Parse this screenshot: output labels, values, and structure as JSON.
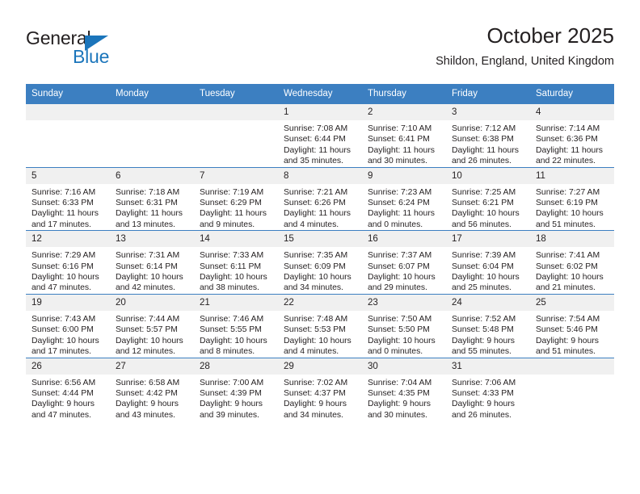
{
  "logo": {
    "text_top": "General",
    "text_bottom": "Blue",
    "brand_color": "#1b75bb",
    "flag_icon": "triangle-flag-icon"
  },
  "header": {
    "title": "October 2025",
    "subtitle": "Shildon, England, United Kingdom"
  },
  "calendar": {
    "header_color": "#3c7fc1",
    "daynum_background": "#f0f0f0",
    "weekday_headers": [
      "Sunday",
      "Monday",
      "Tuesday",
      "Wednesday",
      "Thursday",
      "Friday",
      "Saturday"
    ],
    "weeks": [
      [
        {
          "empty": true
        },
        {
          "empty": true
        },
        {
          "empty": true
        },
        {
          "day": "1",
          "sunrise": "Sunrise: 7:08 AM",
          "sunset": "Sunset: 6:44 PM",
          "daylight_1": "Daylight: 11 hours",
          "daylight_2": "and 35 minutes."
        },
        {
          "day": "2",
          "sunrise": "Sunrise: 7:10 AM",
          "sunset": "Sunset: 6:41 PM",
          "daylight_1": "Daylight: 11 hours",
          "daylight_2": "and 30 minutes."
        },
        {
          "day": "3",
          "sunrise": "Sunrise: 7:12 AM",
          "sunset": "Sunset: 6:38 PM",
          "daylight_1": "Daylight: 11 hours",
          "daylight_2": "and 26 minutes."
        },
        {
          "day": "4",
          "sunrise": "Sunrise: 7:14 AM",
          "sunset": "Sunset: 6:36 PM",
          "daylight_1": "Daylight: 11 hours",
          "daylight_2": "and 22 minutes."
        }
      ],
      [
        {
          "day": "5",
          "sunrise": "Sunrise: 7:16 AM",
          "sunset": "Sunset: 6:33 PM",
          "daylight_1": "Daylight: 11 hours",
          "daylight_2": "and 17 minutes."
        },
        {
          "day": "6",
          "sunrise": "Sunrise: 7:18 AM",
          "sunset": "Sunset: 6:31 PM",
          "daylight_1": "Daylight: 11 hours",
          "daylight_2": "and 13 minutes."
        },
        {
          "day": "7",
          "sunrise": "Sunrise: 7:19 AM",
          "sunset": "Sunset: 6:29 PM",
          "daylight_1": "Daylight: 11 hours",
          "daylight_2": "and 9 minutes."
        },
        {
          "day": "8",
          "sunrise": "Sunrise: 7:21 AM",
          "sunset": "Sunset: 6:26 PM",
          "daylight_1": "Daylight: 11 hours",
          "daylight_2": "and 4 minutes."
        },
        {
          "day": "9",
          "sunrise": "Sunrise: 7:23 AM",
          "sunset": "Sunset: 6:24 PM",
          "daylight_1": "Daylight: 11 hours",
          "daylight_2": "and 0 minutes."
        },
        {
          "day": "10",
          "sunrise": "Sunrise: 7:25 AM",
          "sunset": "Sunset: 6:21 PM",
          "daylight_1": "Daylight: 10 hours",
          "daylight_2": "and 56 minutes."
        },
        {
          "day": "11",
          "sunrise": "Sunrise: 7:27 AM",
          "sunset": "Sunset: 6:19 PM",
          "daylight_1": "Daylight: 10 hours",
          "daylight_2": "and 51 minutes."
        }
      ],
      [
        {
          "day": "12",
          "sunrise": "Sunrise: 7:29 AM",
          "sunset": "Sunset: 6:16 PM",
          "daylight_1": "Daylight: 10 hours",
          "daylight_2": "and 47 minutes."
        },
        {
          "day": "13",
          "sunrise": "Sunrise: 7:31 AM",
          "sunset": "Sunset: 6:14 PM",
          "daylight_1": "Daylight: 10 hours",
          "daylight_2": "and 42 minutes."
        },
        {
          "day": "14",
          "sunrise": "Sunrise: 7:33 AM",
          "sunset": "Sunset: 6:11 PM",
          "daylight_1": "Daylight: 10 hours",
          "daylight_2": "and 38 minutes."
        },
        {
          "day": "15",
          "sunrise": "Sunrise: 7:35 AM",
          "sunset": "Sunset: 6:09 PM",
          "daylight_1": "Daylight: 10 hours",
          "daylight_2": "and 34 minutes."
        },
        {
          "day": "16",
          "sunrise": "Sunrise: 7:37 AM",
          "sunset": "Sunset: 6:07 PM",
          "daylight_1": "Daylight: 10 hours",
          "daylight_2": "and 29 minutes."
        },
        {
          "day": "17",
          "sunrise": "Sunrise: 7:39 AM",
          "sunset": "Sunset: 6:04 PM",
          "daylight_1": "Daylight: 10 hours",
          "daylight_2": "and 25 minutes."
        },
        {
          "day": "18",
          "sunrise": "Sunrise: 7:41 AM",
          "sunset": "Sunset: 6:02 PM",
          "daylight_1": "Daylight: 10 hours",
          "daylight_2": "and 21 minutes."
        }
      ],
      [
        {
          "day": "19",
          "sunrise": "Sunrise: 7:43 AM",
          "sunset": "Sunset: 6:00 PM",
          "daylight_1": "Daylight: 10 hours",
          "daylight_2": "and 17 minutes."
        },
        {
          "day": "20",
          "sunrise": "Sunrise: 7:44 AM",
          "sunset": "Sunset: 5:57 PM",
          "daylight_1": "Daylight: 10 hours",
          "daylight_2": "and 12 minutes."
        },
        {
          "day": "21",
          "sunrise": "Sunrise: 7:46 AM",
          "sunset": "Sunset: 5:55 PM",
          "daylight_1": "Daylight: 10 hours",
          "daylight_2": "and 8 minutes."
        },
        {
          "day": "22",
          "sunrise": "Sunrise: 7:48 AM",
          "sunset": "Sunset: 5:53 PM",
          "daylight_1": "Daylight: 10 hours",
          "daylight_2": "and 4 minutes."
        },
        {
          "day": "23",
          "sunrise": "Sunrise: 7:50 AM",
          "sunset": "Sunset: 5:50 PM",
          "daylight_1": "Daylight: 10 hours",
          "daylight_2": "and 0 minutes."
        },
        {
          "day": "24",
          "sunrise": "Sunrise: 7:52 AM",
          "sunset": "Sunset: 5:48 PM",
          "daylight_1": "Daylight: 9 hours",
          "daylight_2": "and 55 minutes."
        },
        {
          "day": "25",
          "sunrise": "Sunrise: 7:54 AM",
          "sunset": "Sunset: 5:46 PM",
          "daylight_1": "Daylight: 9 hours",
          "daylight_2": "and 51 minutes."
        }
      ],
      [
        {
          "day": "26",
          "sunrise": "Sunrise: 6:56 AM",
          "sunset": "Sunset: 4:44 PM",
          "daylight_1": "Daylight: 9 hours",
          "daylight_2": "and 47 minutes."
        },
        {
          "day": "27",
          "sunrise": "Sunrise: 6:58 AM",
          "sunset": "Sunset: 4:42 PM",
          "daylight_1": "Daylight: 9 hours",
          "daylight_2": "and 43 minutes."
        },
        {
          "day": "28",
          "sunrise": "Sunrise: 7:00 AM",
          "sunset": "Sunset: 4:39 PM",
          "daylight_1": "Daylight: 9 hours",
          "daylight_2": "and 39 minutes."
        },
        {
          "day": "29",
          "sunrise": "Sunrise: 7:02 AM",
          "sunset": "Sunset: 4:37 PM",
          "daylight_1": "Daylight: 9 hours",
          "daylight_2": "and 34 minutes."
        },
        {
          "day": "30",
          "sunrise": "Sunrise: 7:04 AM",
          "sunset": "Sunset: 4:35 PM",
          "daylight_1": "Daylight: 9 hours",
          "daylight_2": "and 30 minutes."
        },
        {
          "day": "31",
          "sunrise": "Sunrise: 7:06 AM",
          "sunset": "Sunset: 4:33 PM",
          "daylight_1": "Daylight: 9 hours",
          "daylight_2": "and 26 minutes."
        },
        {
          "empty": true
        }
      ]
    ]
  }
}
